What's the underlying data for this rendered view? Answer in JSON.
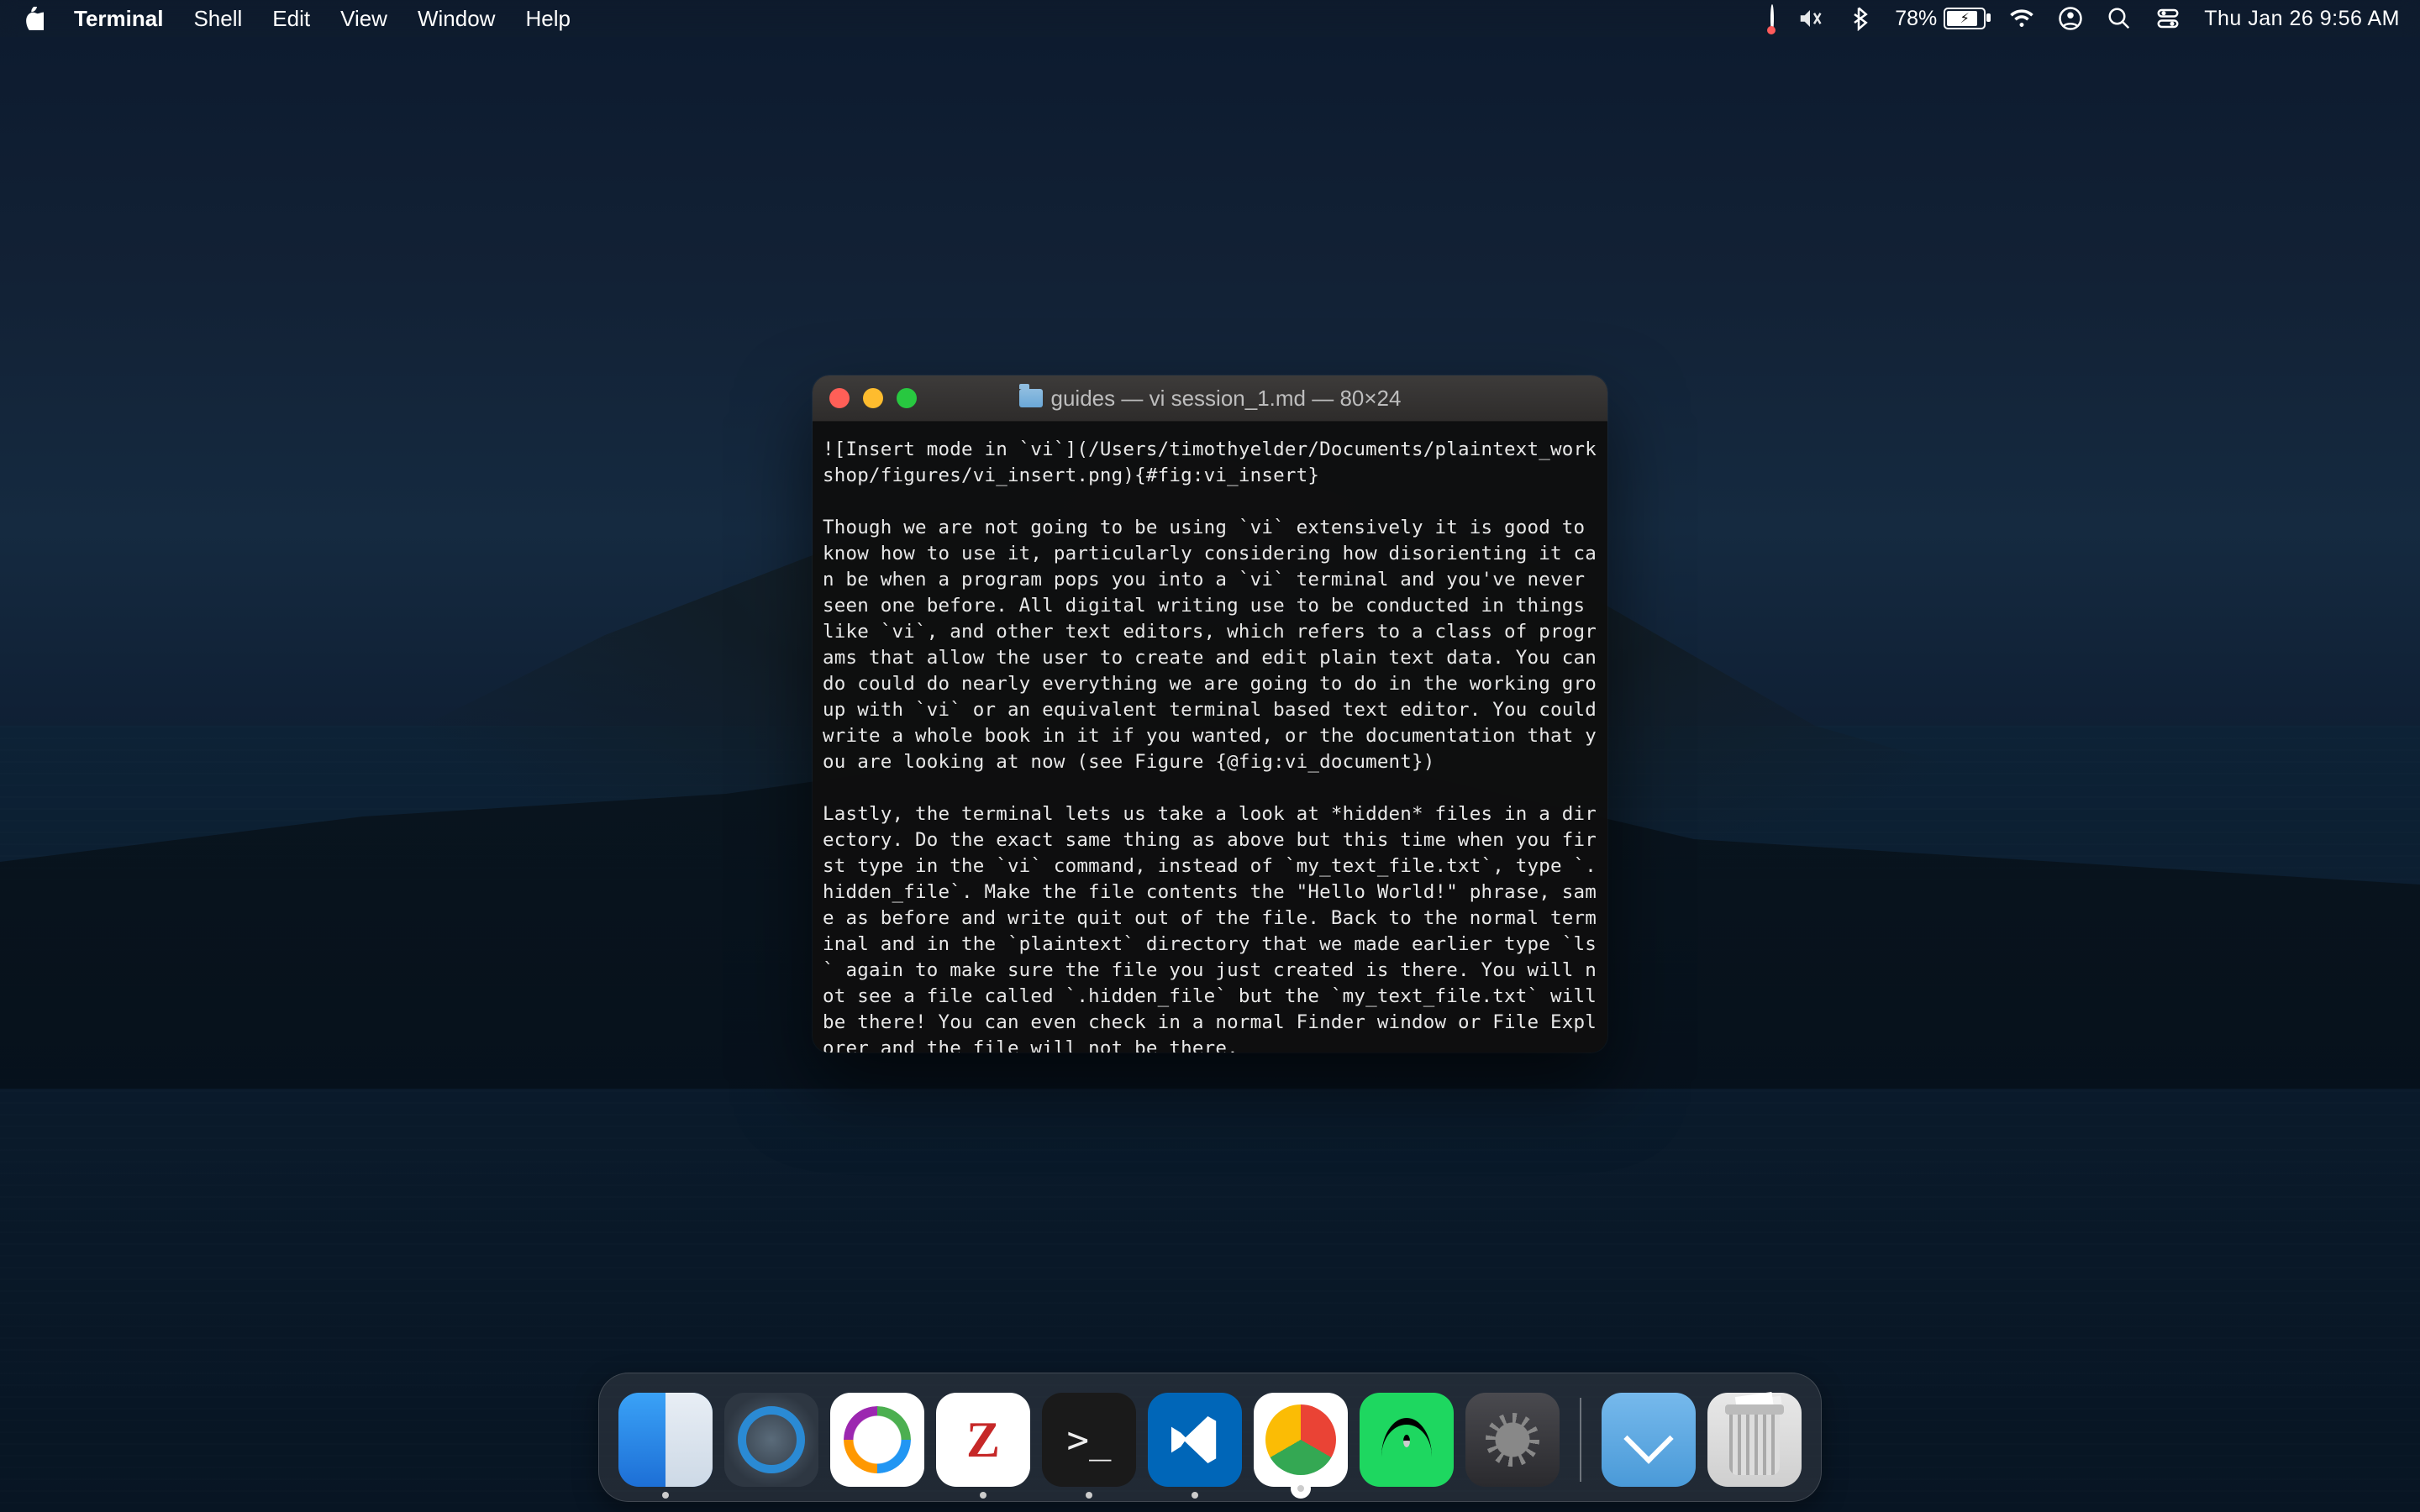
{
  "menubar": {
    "app": "Terminal",
    "items": [
      "Shell",
      "Edit",
      "View",
      "Window",
      "Help"
    ],
    "battery_pct": "78%",
    "clock": "Thu Jan 26  9:56 AM"
  },
  "window": {
    "title": "guides — vi session_1.md — 80×24",
    "content": "![Insert mode in `vi`](/Users/timothyelder/Documents/plaintext_workshop/figures/vi_insert.png){#fig:vi_insert}\n\nThough we are not going to be using `vi` extensively it is good to know how to use it, particularly considering how disorienting it can be when a program pops you into a `vi` terminal and you've never seen one before. All digital writing use to be conducted in things like `vi`, and other text editors, which refers to a class of programs that allow the user to create and edit plain text data. You can do could do nearly everything we are going to do in the working group with `vi` or an equivalent terminal based text editor. You could write a whole book in it if you wanted, or the documentation that you are looking at now (see Figure {@fig:vi_document})\n\nLastly, the terminal lets us take a look at *hidden* files in a directory. Do the exact same thing as above but this time when you first type in the `vi` command, instead of `my_text_file.txt`, type `.hidden_file`. Make the file contents the \"Hello World!\" phrase, same as before and write quit out of the file. Back to the normal terminal and in the `plaintext` directory that we made earlier type `ls` again to make sure the file you just created is there. You will not see a file called `.hidden_file` but the `my_text_file.txt` will be there! You can even check in a normal Finder window or File Explorer and the file will not be there."
  },
  "dock": {
    "items": [
      {
        "name": "finder",
        "label": "Finder",
        "running": true
      },
      {
        "name": "quicktime",
        "label": "QuickTime Player",
        "running": false
      },
      {
        "name": "globe-app",
        "label": "App",
        "running": false
      },
      {
        "name": "zotero",
        "label": "Zotero",
        "running": true,
        "glyph": "Z"
      },
      {
        "name": "terminal",
        "label": "Terminal",
        "running": true
      },
      {
        "name": "vscode",
        "label": "Visual Studio Code",
        "running": true
      },
      {
        "name": "chrome",
        "label": "Google Chrome",
        "running": true
      },
      {
        "name": "spotify",
        "label": "Spotify",
        "running": true
      },
      {
        "name": "settings",
        "label": "System Settings",
        "running": false
      }
    ],
    "right": [
      {
        "name": "downloads",
        "label": "Downloads"
      },
      {
        "name": "trash",
        "label": "Trash"
      }
    ]
  }
}
